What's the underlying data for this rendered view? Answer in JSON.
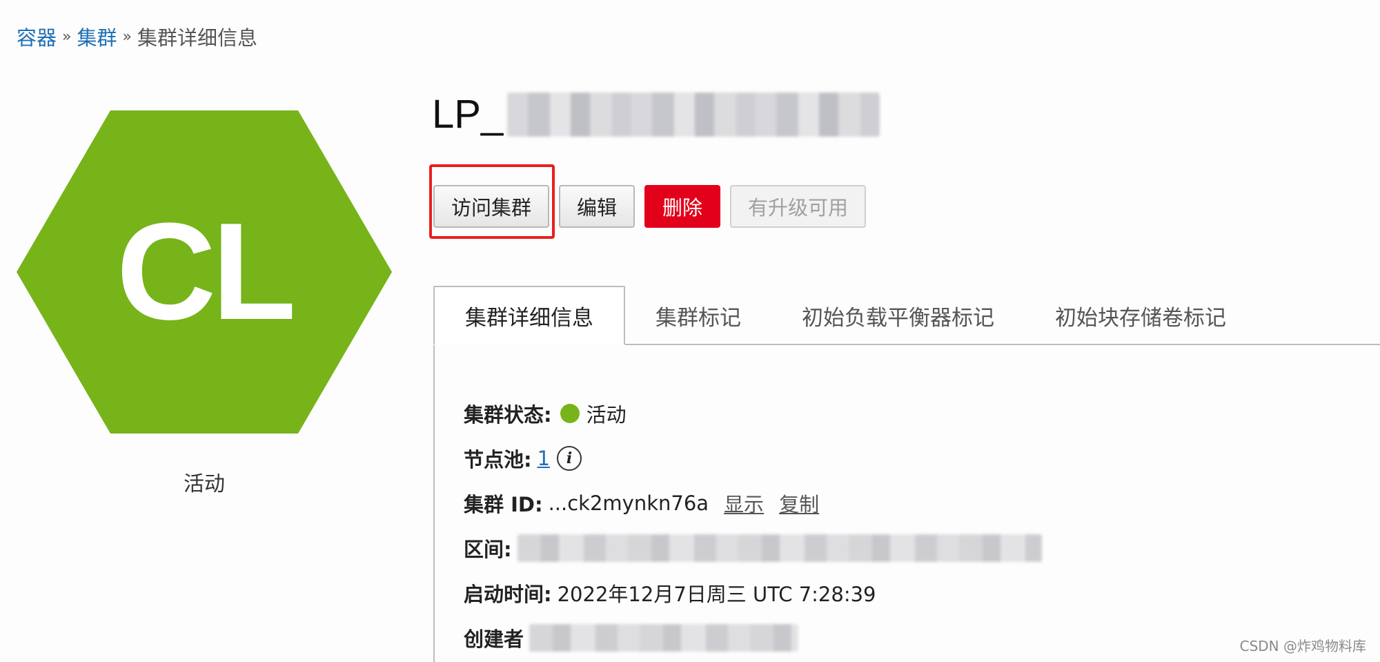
{
  "breadcrumb": {
    "items": [
      "容器",
      "集群"
    ],
    "separator": "»",
    "current": "集群详细信息"
  },
  "logo": {
    "initials": "CL",
    "color": "#76b41a",
    "status": "活动"
  },
  "cluster": {
    "name_prefix": "LP_"
  },
  "actions": {
    "access": "访问集群",
    "edit": "编辑",
    "delete": "删除",
    "upgrade": "有升级可用"
  },
  "tabs": [
    {
      "label": "集群详细信息",
      "active": true
    },
    {
      "label": "集群标记",
      "active": false
    },
    {
      "label": "初始负载平衡器标记",
      "active": false
    },
    {
      "label": "初始块存储卷标记",
      "active": false
    }
  ],
  "details": {
    "status_label": "集群状态:",
    "status_value": "活动",
    "status_color": "#76b41a",
    "nodepool_label": "节点池:",
    "nodepool_value": "1",
    "id_label": "集群 ID:",
    "id_value": "...ck2mynkn76a",
    "id_show": "显示",
    "id_copy": "复制",
    "region_label": "区间:",
    "started_label": "启动时间:",
    "started_value": "2022年12月7日周三 UTC 7:28:39",
    "creator_label": "创建者"
  },
  "colors": {
    "link": "#1f6fb5",
    "danger": "#e3001b",
    "highlight": "#e8201f"
  },
  "watermark": "CSDN @炸鸡物料库"
}
